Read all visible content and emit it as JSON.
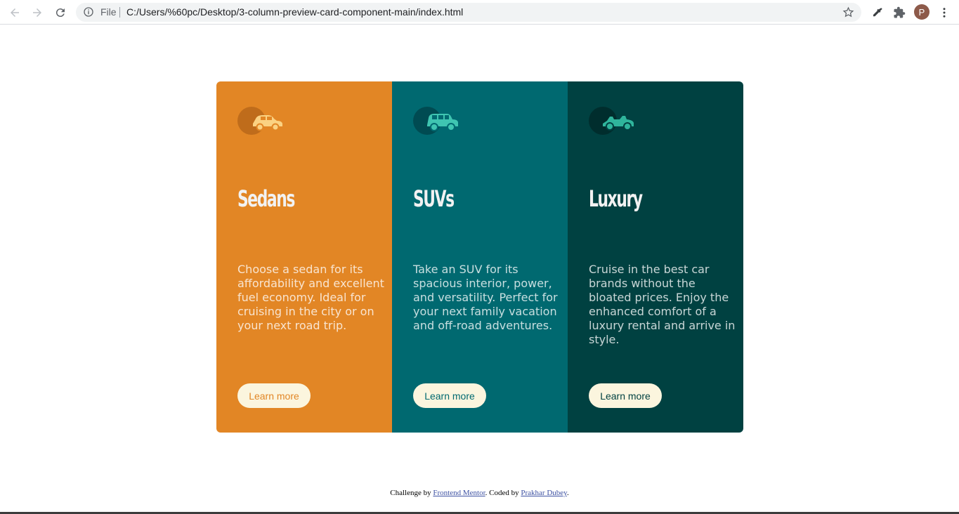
{
  "browser": {
    "file_label": "File",
    "url": "C:/Users/%60pc/Desktop/3-column-preview-card-component-main/index.html",
    "avatar_letter": "P"
  },
  "cards": [
    {
      "title": "Sedans",
      "text": "Choose a sedan for its affordability and excellent fuel economy. Ideal for cruising in the city or on your next road trip.",
      "button": "Learn more",
      "icon": "sedan-icon",
      "color": "#e28625"
    },
    {
      "title": "SUVs",
      "text": "Take an SUV for its spacious interior, power, and versatility. Perfect for your next family vacation and off-road adventures.",
      "button": "Learn more",
      "icon": "suv-icon",
      "color": "#006970"
    },
    {
      "title": "Luxury",
      "text": "Cruise in the best car brands without the bloated prices. Enjoy the enhanced comfort of a luxury rental and arrive in style.",
      "button": "Learn more",
      "icon": "luxury-car-icon",
      "color": "#004141"
    }
  ],
  "attribution": {
    "prefix": "Challenge by ",
    "link1": "Frontend Mentor",
    "middle": ". Coded by ",
    "link2": "Prakhar Dubey",
    "suffix": "."
  }
}
